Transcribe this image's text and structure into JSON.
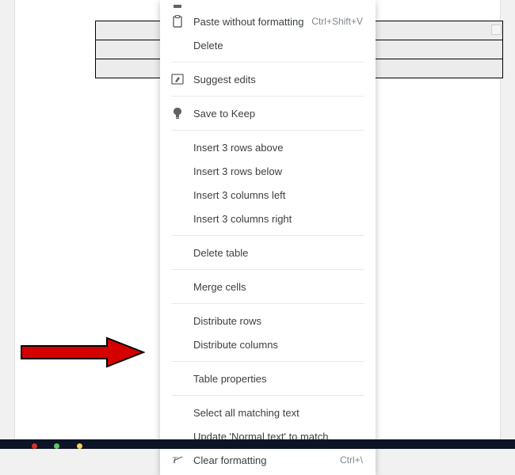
{
  "menu": {
    "paste_without_formatting": {
      "label": "Paste without formatting",
      "shortcut": "Ctrl+Shift+V"
    },
    "delete": {
      "label": "Delete"
    },
    "suggest_edits": {
      "label": "Suggest edits"
    },
    "save_to_keep": {
      "label": "Save to Keep"
    },
    "insert_rows_above": {
      "label": "Insert 3 rows above"
    },
    "insert_rows_below": {
      "label": "Insert 3 rows below"
    },
    "insert_cols_left": {
      "label": "Insert 3 columns left"
    },
    "insert_cols_right": {
      "label": "Insert 3 columns right"
    },
    "delete_table": {
      "label": "Delete table"
    },
    "merge_cells": {
      "label": "Merge cells"
    },
    "distribute_rows": {
      "label": "Distribute rows"
    },
    "distribute_columns": {
      "label": "Distribute columns"
    },
    "table_properties": {
      "label": "Table properties"
    },
    "select_matching": {
      "label": "Select all matching text"
    },
    "update_style": {
      "label": "Update 'Normal text' to match"
    },
    "clear_formatting": {
      "label": "Clear formatting",
      "shortcut": "Ctrl+\\"
    }
  }
}
